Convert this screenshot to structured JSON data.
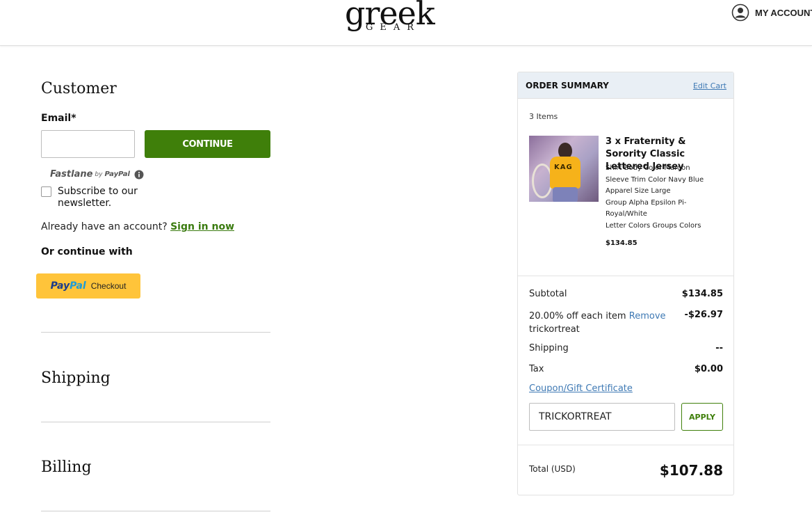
{
  "header": {
    "logo_main": "greek",
    "logo_sub": "GEAR",
    "account_label": "MY ACCOUNT"
  },
  "customer": {
    "title": "Customer",
    "email_label": "Email*",
    "email_value": "",
    "continue_label": "CONTINUE",
    "fastlane_word": "Fastlane",
    "fastlane_by": "by",
    "fastlane_paypal": "PayPal",
    "newsletter_label": "Subscribe to our newsletter.",
    "account_prompt": "Already have an account?",
    "signin_label": "Sign in now",
    "or_continue": "Or continue with",
    "paypal_pay": "Pay",
    "paypal_pal": "Pal",
    "paypal_checkout": "Checkout"
  },
  "sections": {
    "shipping_title": "Shipping",
    "billing_title": "Billing"
  },
  "summary": {
    "title": "ORDER SUMMARY",
    "edit_cart": "Edit Cart",
    "items_count": "3 Items",
    "product": {
      "name": "3 x Fraternity & Sorority Classic Lettered Jersey",
      "options": [
        "Shirt Body Color Maroon",
        "Sleeve Trim Color Navy Blue",
        "Apparel Size Large",
        "Group Alpha Epsilon Pi-",
        "Royal/White",
        "Letter Colors Groups Colors"
      ],
      "price": "$134.85",
      "image_letters": "KAG"
    },
    "subtotal_label": "Subtotal",
    "subtotal_value": "$134.85",
    "discount_label": "20.00% off each item",
    "discount_remove": "Remove",
    "discount_code": "trickortreat",
    "discount_value": "-$26.97",
    "shipping_label": "Shipping",
    "shipping_value": "--",
    "tax_label": "Tax",
    "tax_value": "$0.00",
    "coupon_link": "Coupon/Gift Certificate",
    "coupon_value": "TRICKORTREAT",
    "apply_label": "APPLY",
    "total_label": "Total (USD)",
    "total_value": "$107.88"
  },
  "colors": {
    "brand_green": "#3f7f0a",
    "link_blue": "#3e79b4",
    "paypal_yellow": "#ffc43a"
  }
}
